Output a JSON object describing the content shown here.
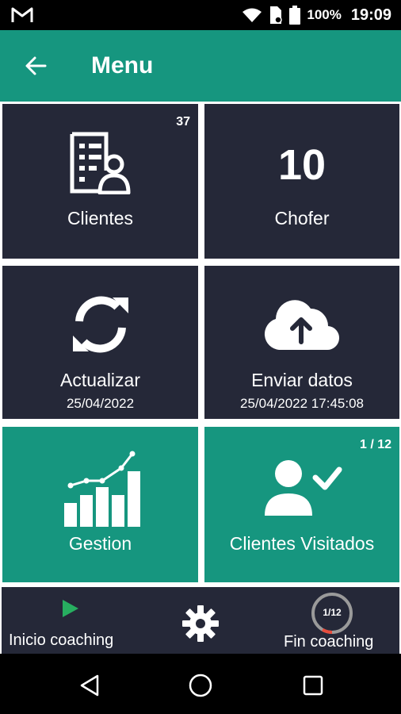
{
  "status_bar": {
    "battery": "100%",
    "time": "19:09"
  },
  "app_bar": {
    "title": "Menu"
  },
  "tiles": {
    "clientes": {
      "label": "Clientes",
      "badge": "37",
      "icon": "client-list-icon"
    },
    "chofer": {
      "label": "Chofer",
      "number": "10"
    },
    "actualizar": {
      "label": "Actualizar",
      "date": "25/04/2022",
      "icon": "sync-icon"
    },
    "enviar": {
      "label": "Enviar datos",
      "date": "25/04/2022 17:45:08",
      "icon": "cloud-upload-icon"
    },
    "gestion": {
      "label": "Gestion",
      "icon": "bar-chart-icon"
    },
    "visitados": {
      "label": "Clientes Visitados",
      "badge": "1 / 12",
      "icon": "user-check-icon"
    }
  },
  "bottom_bar": {
    "inicio_label": "Inicio coaching",
    "fin_label": "Fin coaching",
    "progress_text": "1/12",
    "progress_fraction": 0.0833
  },
  "colors": {
    "teal": "#16967f",
    "tile_dark": "#252838",
    "play_green": "#27ae60",
    "progress_red": "#e74c3c"
  }
}
